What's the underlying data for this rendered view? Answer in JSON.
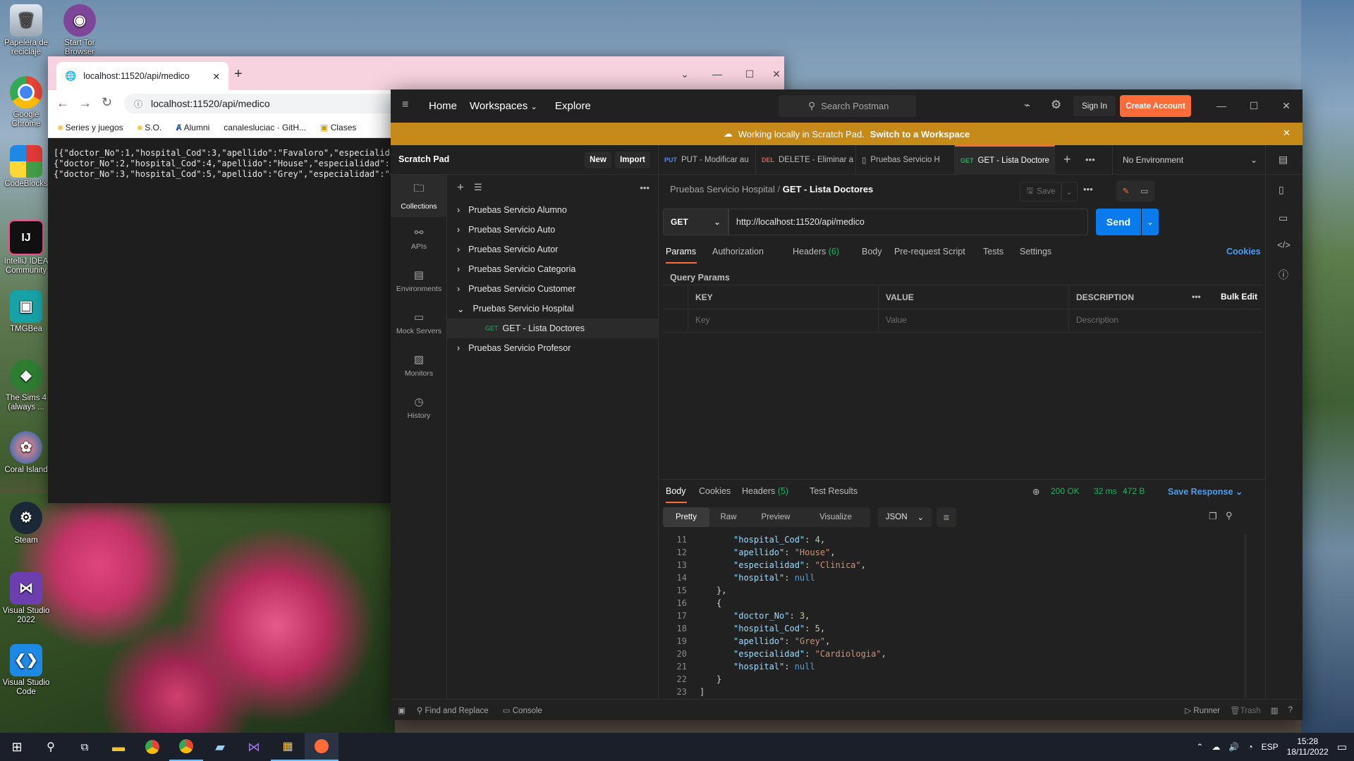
{
  "desktop": {
    "icons": [
      {
        "label": "Papelera de reciclaje",
        "icon": "recycle-bin-icon"
      },
      {
        "label": "Start Tor Browser",
        "icon": "tor-browser-icon"
      },
      {
        "label": "Google Chrome",
        "icon": "chrome-icon"
      },
      {
        "label": "CodeBlocks",
        "icon": "codeblocks-icon"
      },
      {
        "label": "IntelliJ IDEA Community",
        "icon": "intellij-icon"
      },
      {
        "label": "TMGBea",
        "icon": "tmg-icon"
      },
      {
        "label": "The Sims 4 (always ...",
        "icon": "sims-icon"
      },
      {
        "label": "Coral Island",
        "icon": "coral-island-icon"
      },
      {
        "label": "Steam",
        "icon": "steam-icon"
      },
      {
        "label": "Visual Studio 2022",
        "icon": "visual-studio-icon"
      },
      {
        "label": "Visual Studio Code",
        "icon": "vscode-icon"
      }
    ]
  },
  "chrome": {
    "tab_title": "localhost:11520/api/medico",
    "url": "localhost:11520/api/medico",
    "bookmarks": [
      "Series y juegos",
      "S.O.",
      "Alumni",
      "canalesluciac · GitH...",
      "Clases"
    ],
    "body_lines": [
      "[{\"doctor_No\":1,\"hospital_Cod\":3,\"apellido\":\"Favaloro\",\"especialida",
      "{\"doctor_No\":2,\"hospital_Cod\":4,\"apellido\":\"House\",\"especialidad\":",
      "{\"doctor_No\":3,\"hospital_Cod\":5,\"apellido\":\"Grey\",\"especialidad\":\"C"
    ]
  },
  "postman": {
    "nav": {
      "home": "Home",
      "workspaces": "Workspaces",
      "explore": "Explore"
    },
    "search_placeholder": "Search Postman",
    "sign_in": "Sign In",
    "create_account": "Create Account",
    "banner_text": "Working locally in Scratch Pad.",
    "banner_link": "Switch to a Workspace",
    "sidebar": {
      "title": "Scratch Pad",
      "new": "New",
      "import": "Import",
      "rail": [
        "Collections",
        "APIs",
        "Environments",
        "Mock Servers",
        "Monitors",
        "History"
      ],
      "collections": [
        "Pruebas Servicio Alumno",
        "Pruebas Servicio Auto",
        "Pruebas Servicio Autor",
        "Pruebas Servicio Categoria",
        "Pruebas Servicio Customer",
        "Pruebas Servicio Hospital",
        "Pruebas Servicio Profesor"
      ],
      "child_method": "GET",
      "child_request": "GET - Lista Doctores"
    },
    "tabs": [
      {
        "method": "PUT",
        "label": "PUT - Modificar au",
        "color": "#4a8cf7"
      },
      {
        "method": "DEL",
        "label": "DELETE - Eliminar a",
        "color": "#f05454"
      },
      {
        "method": "",
        "label": "Pruebas Servicio H",
        "color": "#bdbdbd"
      },
      {
        "method": "GET",
        "label": "GET - Lista Doctore",
        "color": "#27ae60"
      }
    ],
    "environment": "No Environment",
    "breadcrumb": {
      "collection": "Pruebas Servicio Hospital",
      "request": "GET - Lista Doctores"
    },
    "save": "Save",
    "method": "GET",
    "url": "http://localhost:11520/api/medico",
    "send": "Send",
    "req_tabs": [
      "Params",
      "Authorization",
      "Headers",
      "Body",
      "Pre-request Script",
      "Tests",
      "Settings"
    ],
    "headers_count": "(6)",
    "cookies": "Cookies",
    "query_params_title": "Query Params",
    "table_headers": [
      "KEY",
      "VALUE",
      "DESCRIPTION"
    ],
    "bulk_edit": "Bulk Edit",
    "placeholders": {
      "key": "Key",
      "value": "Value",
      "description": "Description"
    },
    "response": {
      "tabs": [
        "Body",
        "Cookies",
        "Headers",
        "Test Results"
      ],
      "headers_count": "(5)",
      "status": "200 OK",
      "time": "32 ms",
      "size": "472 B",
      "save_response": "Save Response",
      "views": [
        "Pretty",
        "Raw",
        "Preview",
        "Visualize"
      ],
      "format": "JSON",
      "lines": [
        {
          "n": "11",
          "t": [
            [
              "k",
              "\"hospital_Cod\""
            ],
            [
              "p",
              ": "
            ],
            [
              "n",
              "4"
            ],
            [
              "p",
              ","
            ]
          ],
          "i": 2
        },
        {
          "n": "12",
          "t": [
            [
              "k",
              "\"apellido\""
            ],
            [
              "p",
              ": "
            ],
            [
              "s",
              "\"House\""
            ],
            [
              "p",
              ","
            ]
          ],
          "i": 2
        },
        {
          "n": "13",
          "t": [
            [
              "k",
              "\"especialidad\""
            ],
            [
              "p",
              ": "
            ],
            [
              "s",
              "\"Clinica\""
            ],
            [
              "p",
              ","
            ]
          ],
          "i": 2
        },
        {
          "n": "14",
          "t": [
            [
              "k",
              "\"hospital\""
            ],
            [
              "p",
              ": "
            ],
            [
              "nl",
              "null"
            ]
          ],
          "i": 2
        },
        {
          "n": "15",
          "t": [
            [
              "p",
              "},"
            ]
          ],
          "i": 1
        },
        {
          "n": "16",
          "t": [
            [
              "p",
              "{"
            ]
          ],
          "i": 1
        },
        {
          "n": "17",
          "t": [
            [
              "k",
              "\"doctor_No\""
            ],
            [
              "p",
              ": "
            ],
            [
              "n",
              "3"
            ],
            [
              "p",
              ","
            ]
          ],
          "i": 2
        },
        {
          "n": "18",
          "t": [
            [
              "k",
              "\"hospital_Cod\""
            ],
            [
              "p",
              ": "
            ],
            [
              "n",
              "5"
            ],
            [
              "p",
              ","
            ]
          ],
          "i": 2
        },
        {
          "n": "19",
          "t": [
            [
              "k",
              "\"apellido\""
            ],
            [
              "p",
              ": "
            ],
            [
              "s",
              "\"Grey\""
            ],
            [
              "p",
              ","
            ]
          ],
          "i": 2
        },
        {
          "n": "20",
          "t": [
            [
              "k",
              "\"especialidad\""
            ],
            [
              "p",
              ": "
            ],
            [
              "s",
              "\"Cardiologia\""
            ],
            [
              "p",
              ","
            ]
          ],
          "i": 2
        },
        {
          "n": "21",
          "t": [
            [
              "k",
              "\"hospital\""
            ],
            [
              "p",
              ": "
            ],
            [
              "nl",
              "null"
            ]
          ],
          "i": 2
        },
        {
          "n": "22",
          "t": [
            [
              "p",
              "}"
            ]
          ],
          "i": 1
        },
        {
          "n": "23",
          "t": [
            [
              "p",
              "]"
            ]
          ],
          "i": 0
        }
      ]
    },
    "footer": {
      "find_replace": "Find and Replace",
      "console": "Console",
      "runner": "Runner",
      "trash": "Trash"
    }
  },
  "taskbar": {
    "language": "ESP",
    "time": "15:28",
    "date": "18/11/2022"
  }
}
